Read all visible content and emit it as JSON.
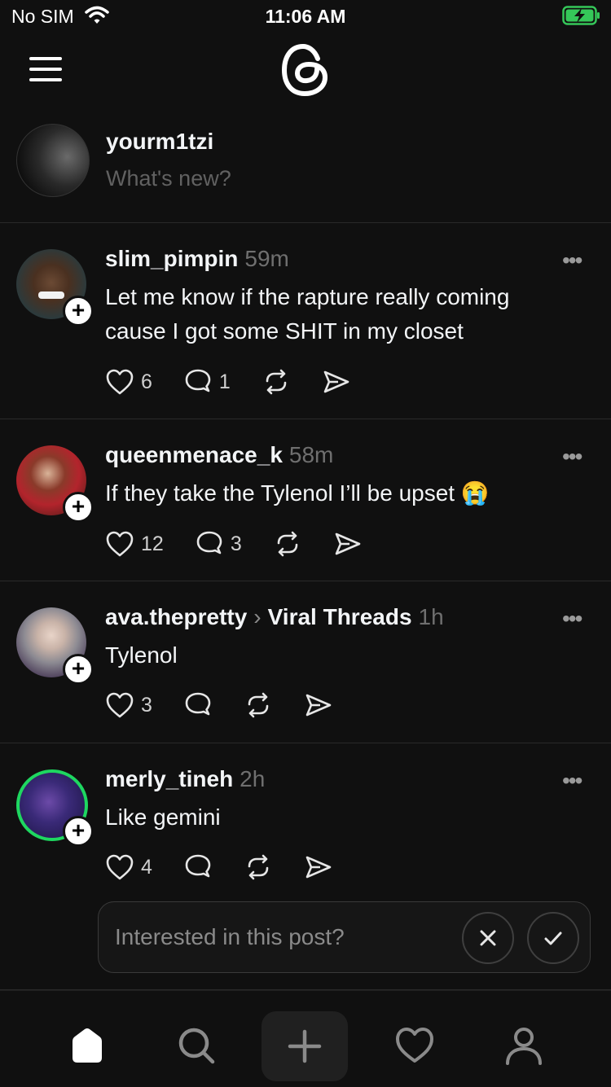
{
  "status_bar": {
    "carrier": "No SIM",
    "time": "11:06 AM"
  },
  "composer": {
    "username": "yourm1tzi",
    "placeholder": "What's new?"
  },
  "posts": [
    {
      "username": "slim_pimpin",
      "time": "59m",
      "text": "Let me know if the rapture really coming cause I got some SHIT in my closet",
      "likes": "6",
      "replies": "1"
    },
    {
      "username": "queenmenace_k",
      "time": "58m",
      "text": "If they take the Tylenol I’ll be upset 😭",
      "likes": "12",
      "replies": "3"
    },
    {
      "username": "ava.thepretty",
      "topic": "Viral Threads",
      "time": "1h",
      "text": "Tylenol",
      "likes": "3"
    },
    {
      "username": "merly_tineh",
      "time": "2h",
      "text": "Like gemini",
      "likes": "4"
    }
  ],
  "interest_prompt": {
    "label": "Interested in this post?"
  },
  "colors": {
    "background": "#101010",
    "accent_online": "#1ed760",
    "text": "#f3f5f7"
  },
  "icons": [
    "wifi-icon",
    "battery-charging-icon",
    "menu-icon",
    "threads-logo-icon",
    "heart-icon",
    "comment-icon",
    "repost-icon",
    "share-icon",
    "more-icon",
    "home-icon",
    "search-icon",
    "plus-icon",
    "activity-icon",
    "profile-icon"
  ]
}
